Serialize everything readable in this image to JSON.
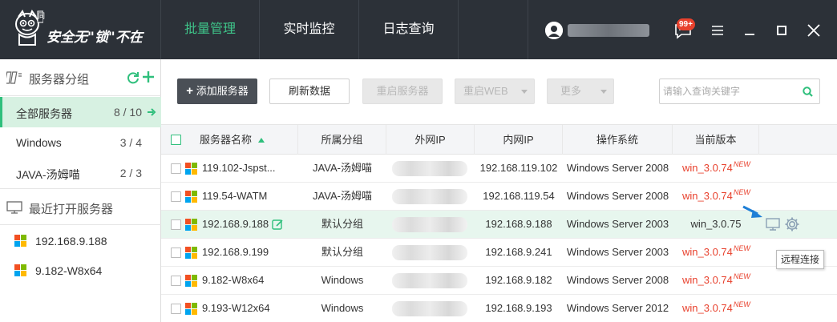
{
  "header": {
    "logo_text": "安全无\"锁\"不在",
    "mascot_badge": "同",
    "nav": [
      {
        "label": "批量管理",
        "active": true
      },
      {
        "label": "实时监控",
        "active": false
      },
      {
        "label": "日志查询",
        "active": false
      }
    ],
    "notification_count": "99+",
    "icons": [
      "user-avatar-icon",
      "chat-icon",
      "menu-icon",
      "minimize-icon",
      "maximize-icon",
      "close-icon"
    ]
  },
  "sidebar": {
    "group_header": "服务器分组",
    "groups": [
      {
        "label": "全部服务器",
        "count": "8 / 10",
        "active": true
      },
      {
        "label": "Windows",
        "count": "3 / 4",
        "active": false
      },
      {
        "label": "JAVA-汤姆喵",
        "count": "2 / 3",
        "active": false
      }
    ],
    "recent_header": "最近打开服务器",
    "recent": [
      {
        "label": "192.168.9.188"
      },
      {
        "label": "9.182-W8x64"
      }
    ]
  },
  "toolbar": {
    "add_label": "添加服务器",
    "refresh_label": "刷新数据",
    "restart_label": "重启服务器",
    "restart_web_label": "重启WEB",
    "more_label": "更多",
    "search_placeholder": "请输入查询关键字"
  },
  "table": {
    "columns": [
      "服务器名称",
      "所属分组",
      "外网IP",
      "内网IP",
      "操作系统",
      "当前版本"
    ],
    "new_badge": "NEW",
    "rows": [
      {
        "name": "119.102-Jspst...",
        "group": "JAVA-汤姆喵",
        "lan_ip": "192.168.119.102",
        "os": "Windows Server 2008",
        "version": "win_3.0.74",
        "is_new": true
      },
      {
        "name": "119.54-WATM",
        "group": "JAVA-汤姆喵",
        "lan_ip": "192.168.119.54",
        "os": "Windows Server 2008",
        "version": "win_3.0.74",
        "is_new": true
      },
      {
        "name": "192.168.9.188",
        "group": "默认分组",
        "lan_ip": "192.168.9.188",
        "os": "Windows Server 2003",
        "version": "win_3.0.75",
        "is_new": false
      },
      {
        "name": "192.168.9.199",
        "group": "默认分组",
        "lan_ip": "192.168.9.241",
        "os": "Windows Server 2003",
        "version": "win_3.0.74",
        "is_new": true
      },
      {
        "name": "9.182-W8x64",
        "group": "Windows",
        "lan_ip": "192.168.9.182",
        "os": "Windows Server 2008",
        "version": "win_3.0.74",
        "is_new": true
      },
      {
        "name": "9.193-W12x64",
        "group": "Windows",
        "lan_ip": "192.168.9.193",
        "os": "Windows Server 2012",
        "version": "win_3.0.74",
        "is_new": true
      }
    ]
  },
  "tooltip": "远程连接",
  "colors": {
    "accent": "#2fbf7c",
    "topbar": "#2c3138",
    "version_red": "#e8412d",
    "row_highlight": "#e7f6ee"
  }
}
